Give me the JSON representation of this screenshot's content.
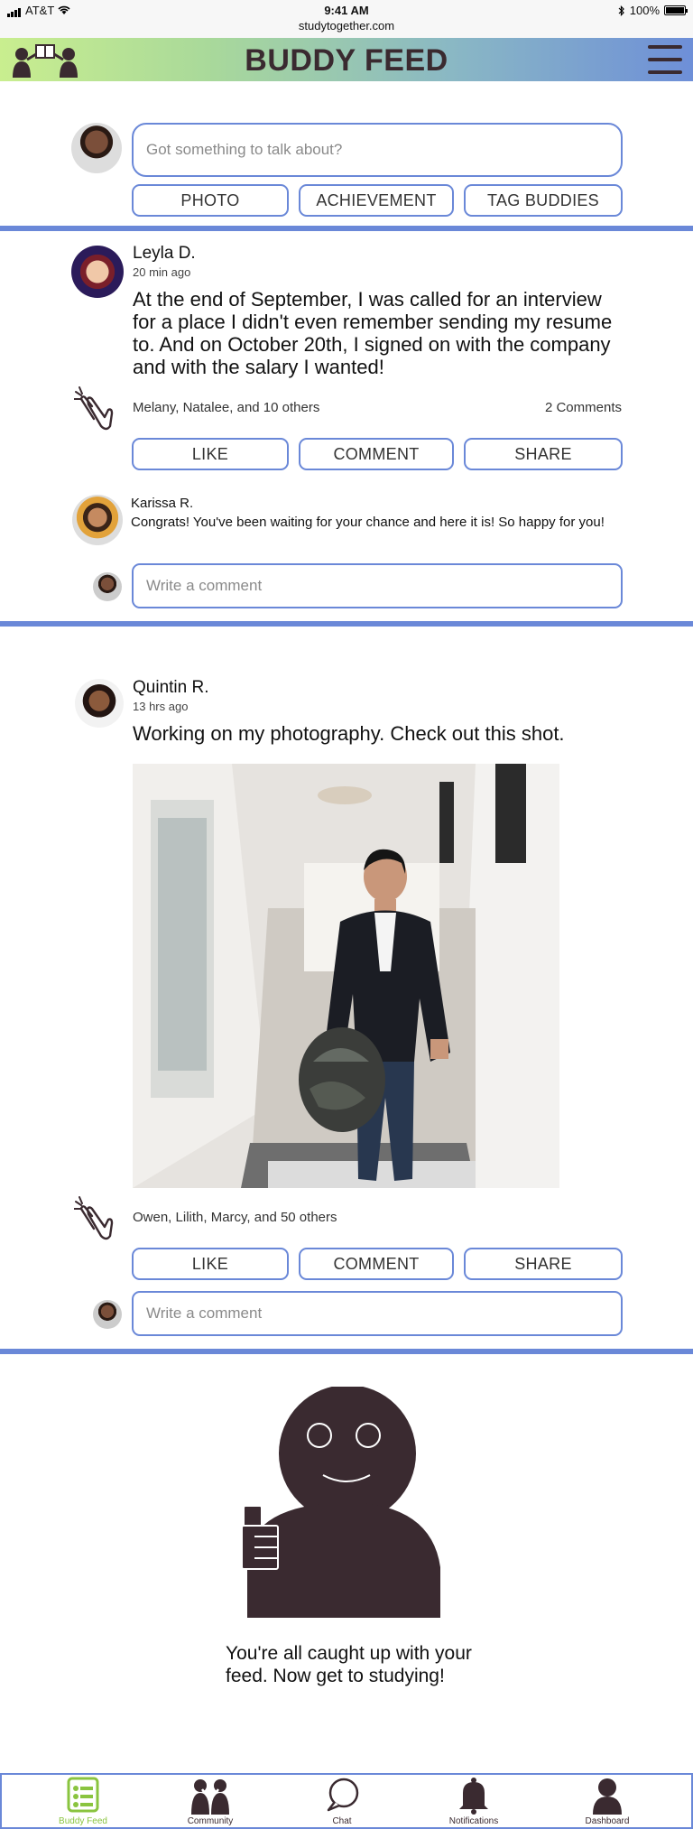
{
  "status_bar": {
    "carrier": "AT&T",
    "time": "9:41 AM",
    "url": "studytogether.com",
    "battery": "100%",
    "icons": [
      "signal-icon",
      "wifi-icon",
      "bluetooth-icon",
      "battery-icon"
    ]
  },
  "header": {
    "title": "BUDDY FEED",
    "icons": [
      "buddies-logo-icon",
      "hamburger-menu-icon"
    ]
  },
  "composer": {
    "placeholder": "Got something to talk about?",
    "buttons": [
      "PHOTO",
      "ACHIEVEMENT",
      "TAG BUDDIES"
    ]
  },
  "posts": [
    {
      "author": "Leyla D.",
      "time_ago": "20 min ago",
      "text": "At the end of September, I was called for an interview for a place I didn't even remember sending my resume to. And on October 20th, I signed on with the company and with the salary I wanted!",
      "claps": "Melany, Natalee, and 10 others",
      "comments_count": "2 Comments",
      "actions": [
        "LIKE",
        "COMMENT",
        "SHARE"
      ],
      "comments": [
        {
          "author": "Karissa R.",
          "text": "Congrats! You've been waiting for your chance and here it is! So happy for you!"
        }
      ],
      "comment_placeholder": "Write a comment"
    },
    {
      "author": "Quintin R.",
      "time_ago": "13 hrs ago",
      "text": "Working on my photography. Check out this shot.",
      "claps": "Owen, Lilith, Marcy, and 50 others",
      "actions": [
        "LIKE",
        "COMMENT",
        "SHARE"
      ],
      "comment_placeholder": "Write a comment"
    }
  ],
  "caught_up": {
    "line1": "You're all caught up with your",
    "line2": "feed. Now get to studying!"
  },
  "tabbar": {
    "items": [
      {
        "label": "Buddy Feed",
        "icon": "feed-list-icon",
        "active": true,
        "color": "#8ac43f"
      },
      {
        "label": "Community",
        "icon": "community-icon",
        "active": false
      },
      {
        "label": "Chat",
        "icon": "chat-bubble-icon",
        "active": false
      },
      {
        "label": "Notifications",
        "icon": "bell-icon",
        "active": false
      },
      {
        "label": "Dashboard",
        "icon": "person-icon",
        "active": false
      }
    ]
  },
  "colors": {
    "accent_blue": "#6a88d8",
    "brand_dark": "#3a2a30",
    "active_green": "#8ac43f"
  }
}
